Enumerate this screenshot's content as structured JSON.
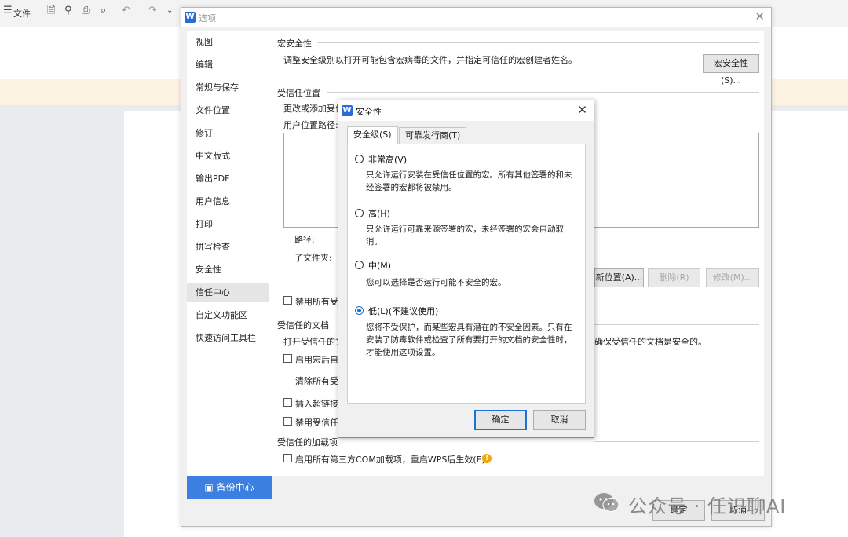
{
  "toolbar": {
    "menu_icon": "hamburger-icon",
    "file_label": "文件"
  },
  "options_dialog": {
    "title": "选项",
    "nav_items": [
      "视图",
      "编辑",
      "常规与保存",
      "文件位置",
      "修订",
      "中文版式",
      "输出PDF",
      "用户信息",
      "打印",
      "拼写检查",
      "安全性",
      "信任中心",
      "自定义功能区",
      "快速访问工具栏"
    ],
    "active_nav": "信任中心",
    "backup_label": "备份中心",
    "macro_section": {
      "title": "宏安全性",
      "description": "调整安全级别以打开可能包含宏病毒的文件，并指定可信任的宏创建者姓名。",
      "button": "宏安全性(S)..."
    },
    "trusted_locations": {
      "title": "受信任位置",
      "description": "更改或添加受信",
      "user_path_label": "用户位置路径:",
      "path_label": "路径:",
      "subfolder_label": "子文件夹:",
      "add_button": "新位置(A)...",
      "remove_button": "删除(R)",
      "modify_button": "修改(M)...",
      "disable_all": "禁用所有受信"
    },
    "trusted_documents": {
      "title": "受信任的文档",
      "description_start": "打开受信任的文",
      "description_end": "确保受信任的文档是安全的。",
      "enable_macros": "启用宏后自",
      "clear_all": "清除所有受",
      "insert_hyperlink": "插入超链接",
      "disable_trusted": "禁用受信任"
    },
    "trusted_addins": {
      "title": "受信任的加载项",
      "enable_com": "启用所有第三方COM加载项，重启WPS后生效(E)"
    },
    "ok_button": "确定",
    "cancel_button": "取消"
  },
  "security_dialog": {
    "title": "安全性",
    "tabs": [
      "安全级(S)",
      "可靠发行商(T)"
    ],
    "active_tab": "安全级(S)",
    "options": [
      {
        "label": "非常高(V)",
        "description": "只允许运行安装在受信任位置的宏。所有其他签署的和未经签署的宏都将被禁用。",
        "checked": false
      },
      {
        "label": "高(H)",
        "description": "只允许运行可靠来源签署的宏，未经签署的宏会自动取消。",
        "checked": false
      },
      {
        "label": "中(M)",
        "description": "您可以选择是否运行可能不安全的宏。",
        "checked": false
      },
      {
        "label": "低(L)(不建议使用)",
        "description": "您将不受保护，而某些宏具有潜在的不安全因素。只有在安装了防毒软件或检查了所有要打开的文档的安全性时，才能使用这项设置。",
        "checked": true
      }
    ],
    "ok_button": "确定",
    "cancel_button": "取消"
  },
  "watermark": "公众号 · 任识聊AI",
  "colors": {
    "accent": "#3b7fe0",
    "radio_selected": "#1e6fd9",
    "warning": "#f2a800"
  }
}
